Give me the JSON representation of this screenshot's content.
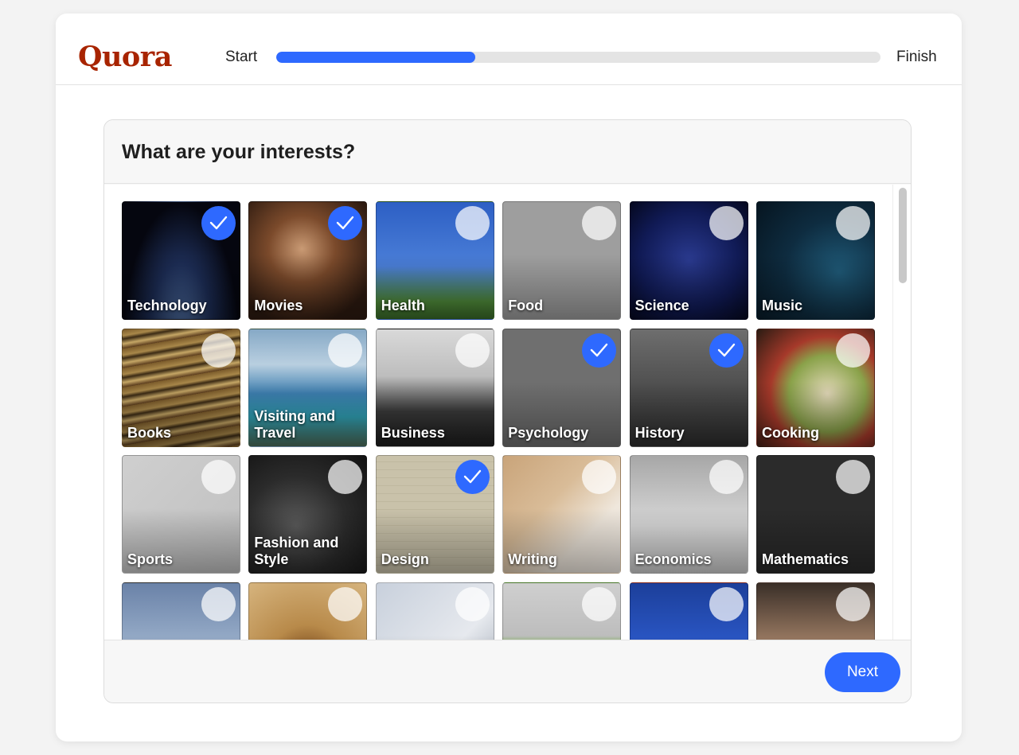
{
  "header": {
    "logo": "Quora",
    "progress_start_label": "Start",
    "progress_finish_label": "Finish",
    "progress_fraction": 0.33
  },
  "card": {
    "title": "What are your interests?",
    "next_label": "Next"
  },
  "colors": {
    "accent": "#2e69ff",
    "brand": "#a82400"
  },
  "topics": [
    {
      "label": "Technology",
      "selected": true,
      "bg": "technology"
    },
    {
      "label": "Movies",
      "selected": true,
      "bg": "movies"
    },
    {
      "label": "Health",
      "selected": false,
      "bg": "health"
    },
    {
      "label": "Food",
      "selected": false,
      "bg": "food"
    },
    {
      "label": "Science",
      "selected": false,
      "bg": "science"
    },
    {
      "label": "Music",
      "selected": false,
      "bg": "music"
    },
    {
      "label": "Books",
      "selected": false,
      "bg": "books"
    },
    {
      "label": "Visiting and Travel",
      "selected": false,
      "bg": "travel"
    },
    {
      "label": "Business",
      "selected": false,
      "bg": "business"
    },
    {
      "label": "Psychology",
      "selected": true,
      "bg": "psychology"
    },
    {
      "label": "History",
      "selected": true,
      "bg": "history"
    },
    {
      "label": "Cooking",
      "selected": false,
      "bg": "cooking"
    },
    {
      "label": "Sports",
      "selected": false,
      "bg": "sports"
    },
    {
      "label": "Fashion and Style",
      "selected": false,
      "bg": "fashion"
    },
    {
      "label": "Design",
      "selected": true,
      "bg": "design"
    },
    {
      "label": "Writing",
      "selected": false,
      "bg": "writing"
    },
    {
      "label": "Economics",
      "selected": false,
      "bg": "economics"
    },
    {
      "label": "Mathematics",
      "selected": false,
      "bg": "mathematics"
    },
    {
      "label": "",
      "selected": false,
      "bg": "philosophy"
    },
    {
      "label": "",
      "selected": false,
      "bg": "law"
    },
    {
      "label": "",
      "selected": false,
      "bg": "finance"
    },
    {
      "label": "",
      "selected": false,
      "bg": "marketing"
    },
    {
      "label": "",
      "selected": false,
      "bg": "education"
    },
    {
      "label": "",
      "selected": false,
      "bg": "tv"
    }
  ]
}
